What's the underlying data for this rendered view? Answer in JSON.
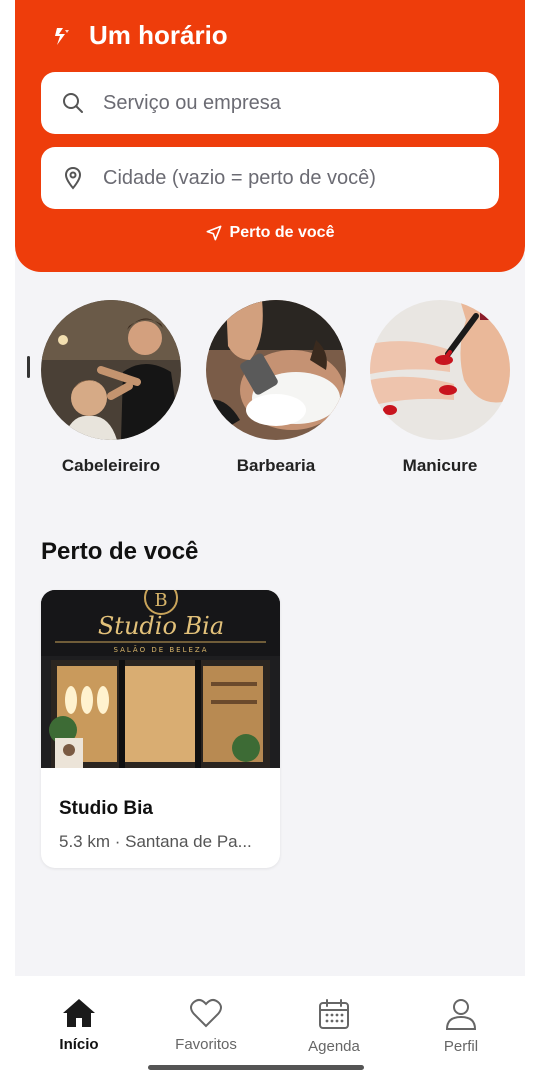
{
  "colors": {
    "accent": "#ee3d0b",
    "background": "#f4f4f7"
  },
  "header": {
    "title": "Um horário",
    "logo_icon": "brand-logo-icon",
    "search": {
      "placeholder": "Serviço ou empresa",
      "value": "",
      "icon": "search-icon"
    },
    "city": {
      "placeholder": "Cidade (vazio = perto de você)",
      "value": "",
      "icon": "location-pin-icon"
    },
    "near_link": {
      "label": "Perto de você",
      "icon": "navigation-arrow-icon"
    }
  },
  "categories": [
    {
      "label": "Cabeleireiro",
      "image": "hairdresser-photo"
    },
    {
      "label": "Barbearia",
      "image": "barbershop-shave-photo"
    },
    {
      "label": "Manicure",
      "image": "manicure-nails-photo"
    }
  ],
  "nearby": {
    "title": "Perto de você",
    "items": [
      {
        "name": "Studio Bia",
        "meta": "5.3 km · Santana de Pa...",
        "image": "studio-bia-storefront-photo",
        "sign_title": "Studio Bia",
        "sign_subtitle": "SALÃO DE BELEZA",
        "sign_monogram": "B"
      }
    ]
  },
  "bottom_nav": {
    "items": [
      {
        "label": "Início",
        "icon": "home-icon",
        "active": true
      },
      {
        "label": "Favoritos",
        "icon": "heart-icon",
        "active": false
      },
      {
        "label": "Agenda",
        "icon": "calendar-icon",
        "active": false
      },
      {
        "label": "Perfil",
        "icon": "user-icon",
        "active": false
      }
    ]
  }
}
